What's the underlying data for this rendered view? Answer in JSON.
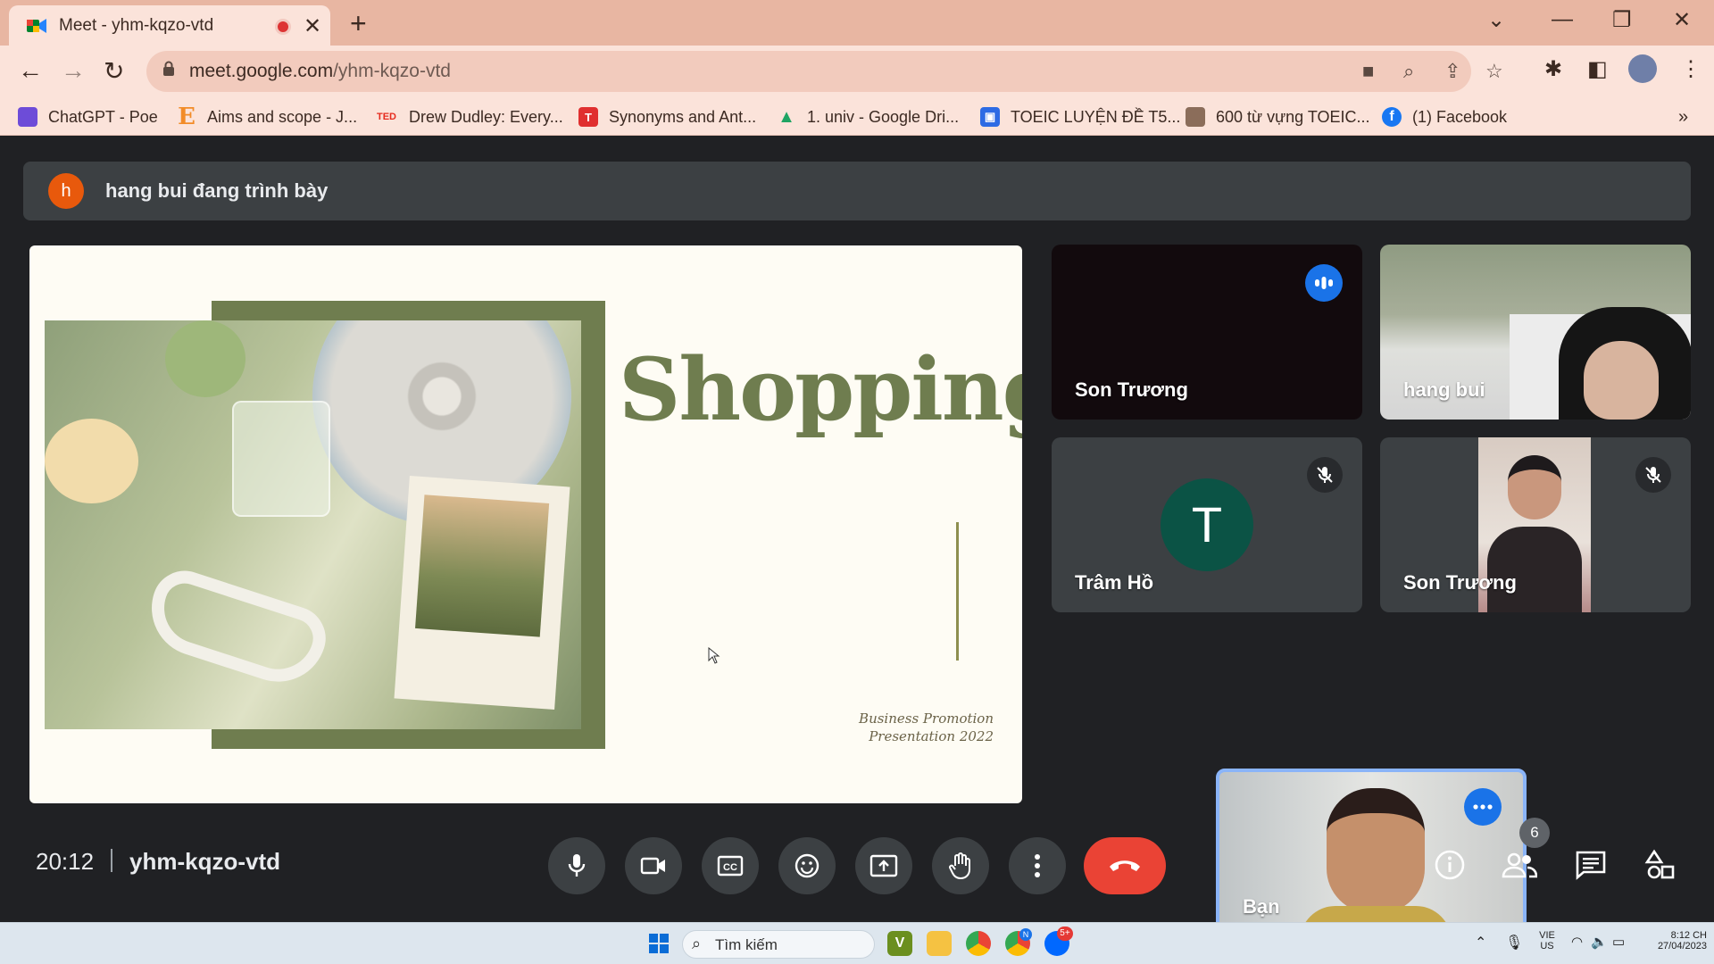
{
  "browser": {
    "tab_title": "Meet - yhm-kqzo-vtd",
    "new_tab_label": "+",
    "url_host": "meet.google.com",
    "url_path": "/yhm-kqzo-vtd",
    "bookmarks": [
      {
        "label": "ChatGPT - Poe",
        "icon": "poe-icon",
        "color": "#6d4cd8",
        "glyph": ""
      },
      {
        "label": "Aims and scope - J...",
        "icon": "elsevier-icon",
        "color": "#f28c28",
        "glyph": "E"
      },
      {
        "label": "Drew Dudley: Every...",
        "icon": "ted-icon",
        "color": "#e62b1e",
        "glyph": "TED"
      },
      {
        "label": "Synonyms and Ant...",
        "icon": "thesaurus-icon",
        "color": "#e02f2f",
        "glyph": "T"
      },
      {
        "label": "1. univ - Google Dri...",
        "icon": "google-drive-icon",
        "color": "#1fa463",
        "glyph": "▲"
      },
      {
        "label": "TOEIC LUYỆN ĐỀ T5...",
        "icon": "classroom-icon",
        "color": "#2d6be4",
        "glyph": "▣"
      },
      {
        "label": "600 từ vựng TOEIC...",
        "icon": "profile-thumb-icon",
        "color": "#8b6d5a",
        "glyph": ""
      },
      {
        "label": "(1) Facebook",
        "icon": "facebook-icon",
        "color": "#1877f2",
        "glyph": "f"
      }
    ]
  },
  "meet": {
    "presenter_initial": "h",
    "presenter_banner": "hang bui đang trình bày",
    "slide": {
      "title": "Shopping",
      "subtitle_line1": "Business Promotion",
      "subtitle_line2": "Presentation 2022"
    },
    "participants": [
      {
        "name": "Son Trương"
      },
      {
        "name": "hang bui"
      },
      {
        "name": "Trâm Hồ",
        "initial": "T"
      },
      {
        "name": "Son Trương"
      },
      {
        "name": "Bạn"
      }
    ],
    "clock": "20:12",
    "meeting_code": "yhm-kqzo-vtd",
    "participant_count": "6"
  },
  "taskbar": {
    "search_placeholder": "Tìm kiếm",
    "lang_top": "VIE",
    "lang_bottom": "US",
    "time": "8:12 CH",
    "date": "27/04/2023",
    "chrome_badge": "N",
    "zalo_badge": "5+"
  },
  "colors": {
    "meet_bg": "#202124",
    "hangup_red": "#ea4335",
    "active_blue": "#1a73e8",
    "chrome_frame": "#e8b6a2"
  }
}
